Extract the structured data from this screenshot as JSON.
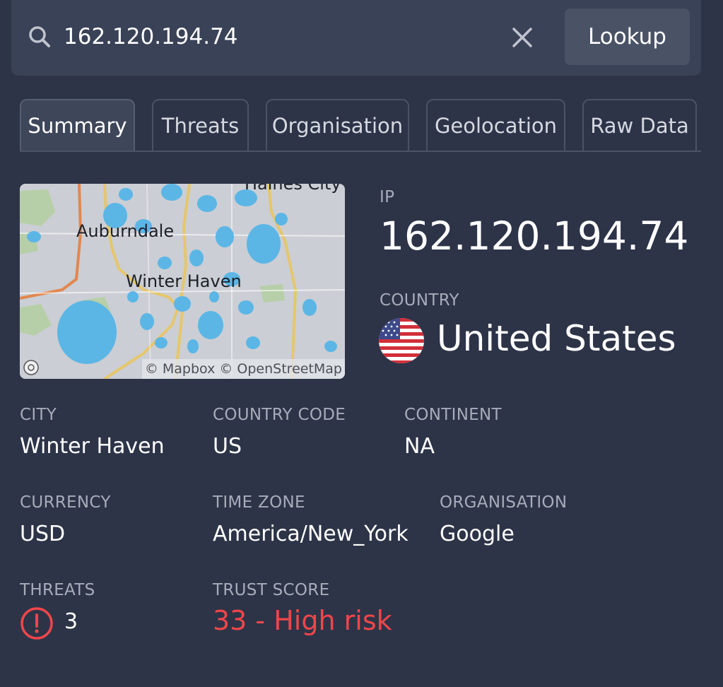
{
  "search": {
    "value": "162.120.194.74",
    "lookup_label": "Lookup"
  },
  "tabs": [
    {
      "label": "Summary",
      "active": true
    },
    {
      "label": "Threats",
      "active": false
    },
    {
      "label": "Organisation",
      "active": false
    },
    {
      "label": "Geolocation",
      "active": false
    },
    {
      "label": "Raw Data",
      "active": false
    }
  ],
  "map": {
    "labels": {
      "top_city": "Haines City",
      "city_a": "Auburndale",
      "city_b": "Winter Haven"
    },
    "attribution": "© Mapbox © OpenStreetMap"
  },
  "summary": {
    "ip": {
      "label": "IP",
      "value": "162.120.194.74"
    },
    "country": {
      "label": "COUNTRY",
      "value": "United States"
    },
    "city": {
      "label": "CITY",
      "value": "Winter Haven"
    },
    "country_code": {
      "label": "COUNTRY CODE",
      "value": "US"
    },
    "continent": {
      "label": "CONTINENT",
      "value": "NA"
    },
    "currency": {
      "label": "CURRENCY",
      "value": "USD"
    },
    "time_zone": {
      "label": "TIME ZONE",
      "value": "America/New_York"
    },
    "organisation": {
      "label": "ORGANISATION",
      "value": "Google"
    },
    "threats": {
      "label": "THREATS",
      "value": "3"
    },
    "trust_score": {
      "label": "TRUST SCORE",
      "value": "33 - High risk"
    }
  },
  "icons": {
    "search": "search-icon",
    "clear": "close-icon",
    "flag": "us-flag-icon",
    "threat": "alert-circle-icon",
    "mapbox": "mapbox-logo-icon"
  },
  "colors": {
    "background": "#2d3448",
    "panel": "#3a4257",
    "danger": "#f0464a",
    "water": "#5bb6e6",
    "road": "#e6c66b"
  }
}
